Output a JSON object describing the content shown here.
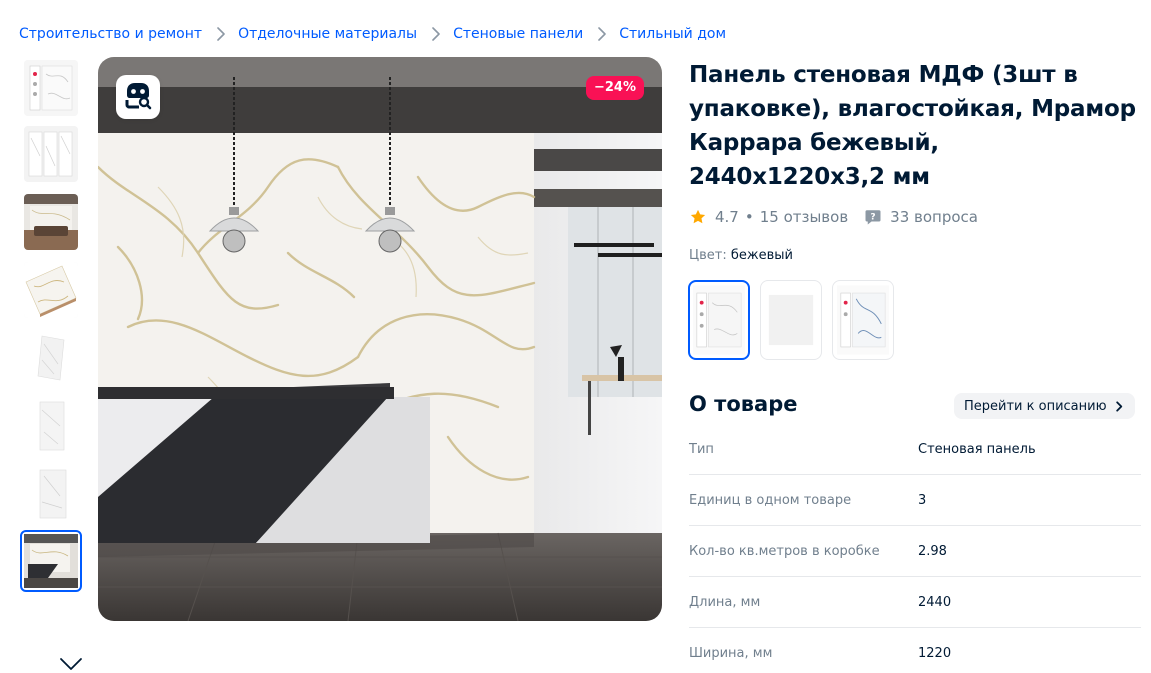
{
  "breadcrumbs": [
    {
      "label": "Строительство и ремонт"
    },
    {
      "label": "Отделочные материалы"
    },
    {
      "label": "Стеновые панели"
    },
    {
      "label": "Стильный дом"
    }
  ],
  "gallery": {
    "discount_badge": "−24%",
    "lens_button_icon": "image-search-icon",
    "thumbnails_count": 8,
    "active_thumbnail_index": 7,
    "thumbs_scroll_icon": "chevron-down-icon"
  },
  "product": {
    "title": "Панель стеновая МДФ (3шт в упаковке), влагостойкая, Мрамор Каррара бежевый, 2440x1220x3,2 мм",
    "rating": "4.7",
    "rating_separator": "•",
    "reviews": "15 отзывов",
    "questions": "33 вопроса",
    "color_label": "Цвет:",
    "color_value": "бежевый"
  },
  "about": {
    "title": "О товаре",
    "goto_description": "Перейти к описанию",
    "specs": [
      {
        "key": "Тип",
        "value": "Стеновая панель"
      },
      {
        "key": "Единиц в одном товаре",
        "value": "3"
      },
      {
        "key": "Кол-во кв.метров в коробке",
        "value": "2.98"
      },
      {
        "key": "Длина, мм",
        "value": "2440"
      },
      {
        "key": "Ширина, мм",
        "value": "1220"
      }
    ]
  },
  "colors": {
    "accent": "#005bff",
    "discount": "#f91155",
    "star": "#ffa800",
    "muted_text": "#707f8d",
    "text": "#001a34"
  }
}
